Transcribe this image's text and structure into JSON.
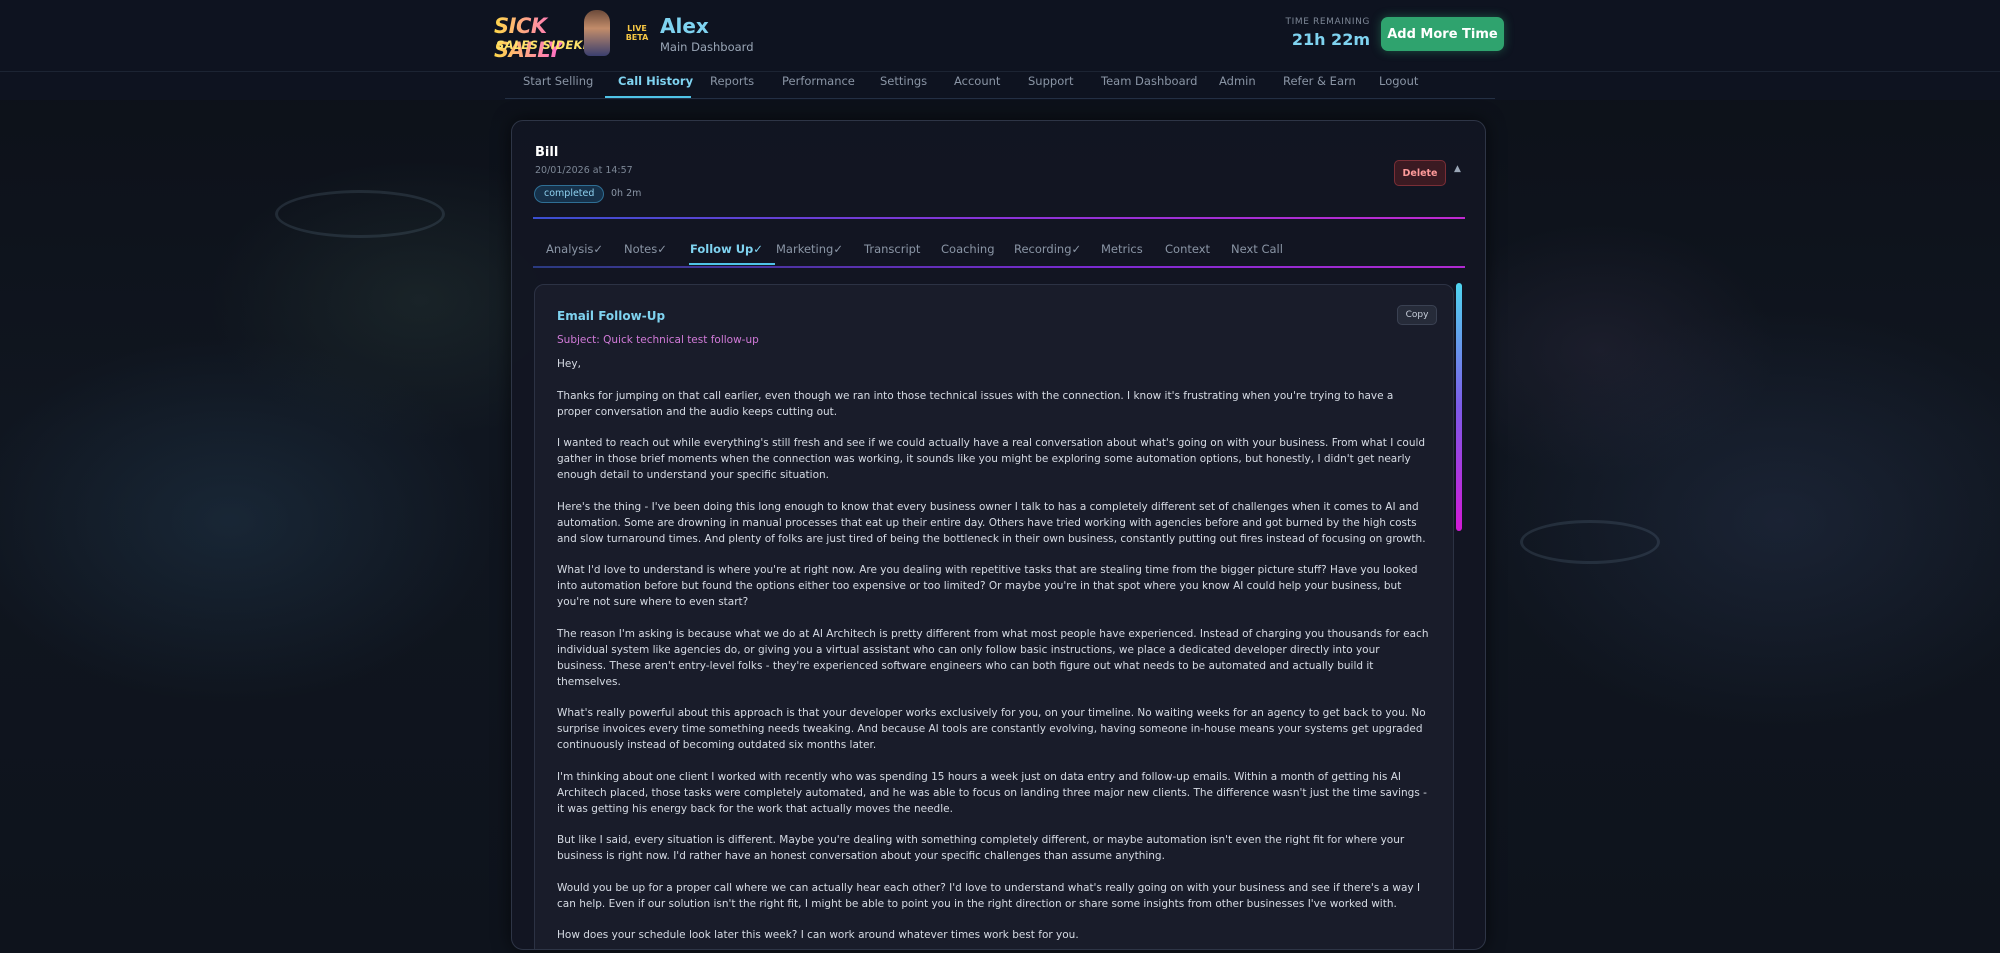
{
  "header": {
    "logo_line1": "SICK SALLY",
    "logo_line2": "SALES SIDEKICK",
    "live_badge": "LIVE",
    "beta_badge": "BETA",
    "user_name": "Alex",
    "user_sub": "Main Dashboard",
    "time_label": "TIME REMAINING",
    "time_value": "21h 22m",
    "add_time_label": "Add More Time"
  },
  "nav": {
    "items": [
      {
        "label": "Start Selling"
      },
      {
        "label": "Call History"
      },
      {
        "label": "Reports"
      },
      {
        "label": "Performance"
      },
      {
        "label": "Settings"
      },
      {
        "label": "Account"
      },
      {
        "label": "Support"
      },
      {
        "label": "Team Dashboard"
      },
      {
        "label": "Admin"
      },
      {
        "label": "Refer & Earn"
      },
      {
        "label": "Logout"
      }
    ],
    "active": "Call History"
  },
  "call": {
    "name": "Bill",
    "datetime": "20/01/2026 at 14:57",
    "status": "completed",
    "duration": "0h 2m",
    "delete_label": "Delete",
    "collapse_glyph": "▲"
  },
  "tabs": {
    "items": [
      {
        "label": "Analysis✓"
      },
      {
        "label": "Notes✓"
      },
      {
        "label": "Follow Up✓"
      },
      {
        "label": "Marketing✓"
      },
      {
        "label": "Transcript"
      },
      {
        "label": "Coaching"
      },
      {
        "label": "Recording✓"
      },
      {
        "label": "Metrics"
      },
      {
        "label": "Context"
      },
      {
        "label": "Next Call"
      }
    ],
    "active": "Follow Up✓"
  },
  "email": {
    "title": "Email Follow-Up",
    "copy_label": "Copy",
    "subject": "Subject: Quick technical test follow-up",
    "paragraphs": [
      "Hey,",
      "Thanks for jumping on that call earlier, even though we ran into those technical issues with the connection. I know it's frustrating when you're trying to have a proper conversation and the audio keeps cutting out.",
      "I wanted to reach out while everything's still fresh and see if we could actually have a real conversation about what's going on with your business. From what I could gather in those brief moments when the connection was working, it sounds like you might be exploring some automation options, but honestly, I didn't get nearly enough detail to understand your specific situation.",
      "Here's the thing - I've been doing this long enough to know that every business owner I talk to has a completely different set of challenges when it comes to AI and automation. Some are drowning in manual processes that eat up their entire day. Others have tried working with agencies before and got burned by the high costs and slow turnaround times. And plenty of folks are just tired of being the bottleneck in their own business, constantly putting out fires instead of focusing on growth.",
      "What I'd love to understand is where you're at right now. Are you dealing with repetitive tasks that are stealing time from the bigger picture stuff? Have you looked into automation before but found the options either too expensive or too limited? Or maybe you're in that spot where you know AI could help your business, but you're not sure where to even start?",
      "The reason I'm asking is because what we do at AI Architech is pretty different from what most people have experienced. Instead of charging you thousands for each individual system like agencies do, or giving you a virtual assistant who can only follow basic instructions, we place a dedicated developer directly into your business. These aren't entry-level folks - they're experienced software engineers who can both figure out what needs to be automated and actually build it themselves.",
      "What's really powerful about this approach is that your developer works exclusively for you, on your timeline. No waiting weeks for an agency to get back to you. No surprise invoices every time something needs tweaking. And because AI tools are constantly evolving, having someone in-house means your systems get upgraded continuously instead of becoming outdated six months later.",
      "I'm thinking about one client I worked with recently who was spending 15 hours a week just on data entry and follow-up emails. Within a month of getting his AI Architech placed, those tasks were completely automated, and he was able to focus on landing three major new clients. The difference wasn't just the time savings - it was getting his energy back for the work that actually moves the needle.",
      "But like I said, every situation is different. Maybe you're dealing with something completely different, or maybe automation isn't even the right fit for where your business is right now. I'd rather have an honest conversation about your specific challenges than assume anything.",
      "Would you be up for a proper call where we can actually hear each other? I'd love to understand what's really going on with your business and see if there's a way I can help. Even if our solution isn't the right fit, I might be able to point you in the right direction or share some insights from other businesses I've worked with.",
      "How does your schedule look later this week? I can work around whatever times work best for you."
    ]
  },
  "colors": {
    "accent": "#7fd3f0",
    "primary_button": "#2fa36e",
    "subject": "#d17ad8",
    "danger": "#ff9a9a"
  }
}
